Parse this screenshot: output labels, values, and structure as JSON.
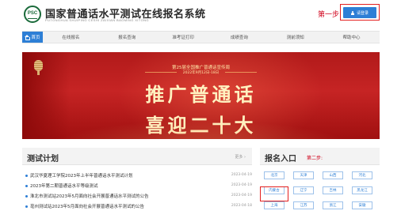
{
  "header": {
    "logo_text": "PSC",
    "title": "国家普通话水平测试在线报名系统",
    "subtitle": "PUTONGHUA SHUIPING CESHI ZAIXIAN BAOMING XITONG",
    "step1_label": "第一步:",
    "login_label": "请登录",
    "login_icon": "user-icon"
  },
  "nav": {
    "items": [
      {
        "label": "首页",
        "active": true,
        "icon": "home-icon"
      },
      {
        "label": "在线报名"
      },
      {
        "label": "报名查询"
      },
      {
        "label": "准考证打印"
      },
      {
        "label": "成绩查询"
      },
      {
        "label": "测前须知"
      },
      {
        "label": "帮助中心"
      }
    ]
  },
  "banner": {
    "event": "第25届全国推广普通话宣传周",
    "date": "2022年9月12日-18日",
    "line1": "推广普通话",
    "line2": "喜迎二十大",
    "icon": "microphone-icon"
  },
  "plans": {
    "title": "测试计划",
    "more_label": "更多",
    "items": [
      {
        "text": "武汉华夏理工学院2023年上半年普通话水平测试计划",
        "date": "2023-04-19"
      },
      {
        "text": "2023年第二期普通话水平等级测试",
        "date": "2023-04-19"
      },
      {
        "text": "淮北市测试站2023年5月面向社会开展普通话水平测试的公告",
        "date": "2023-04-19"
      },
      {
        "text": "亳州测试站2023年5月面向社会开展普通话水平测试的公告",
        "date": "2023-04-18"
      }
    ]
  },
  "apply": {
    "title": "报名入口",
    "step2_label": "第二步:",
    "regions": [
      "北京",
      "天津",
      "山西",
      "河北",
      "内蒙古",
      "辽宁",
      "吉林",
      "黑龙江",
      "上海",
      "江苏",
      "浙江",
      "安徽"
    ]
  },
  "colors": {
    "accent": "#2d7fd6",
    "highlight": "#e32020",
    "banner_red": "#c62424",
    "step_red": "#d0021b"
  }
}
